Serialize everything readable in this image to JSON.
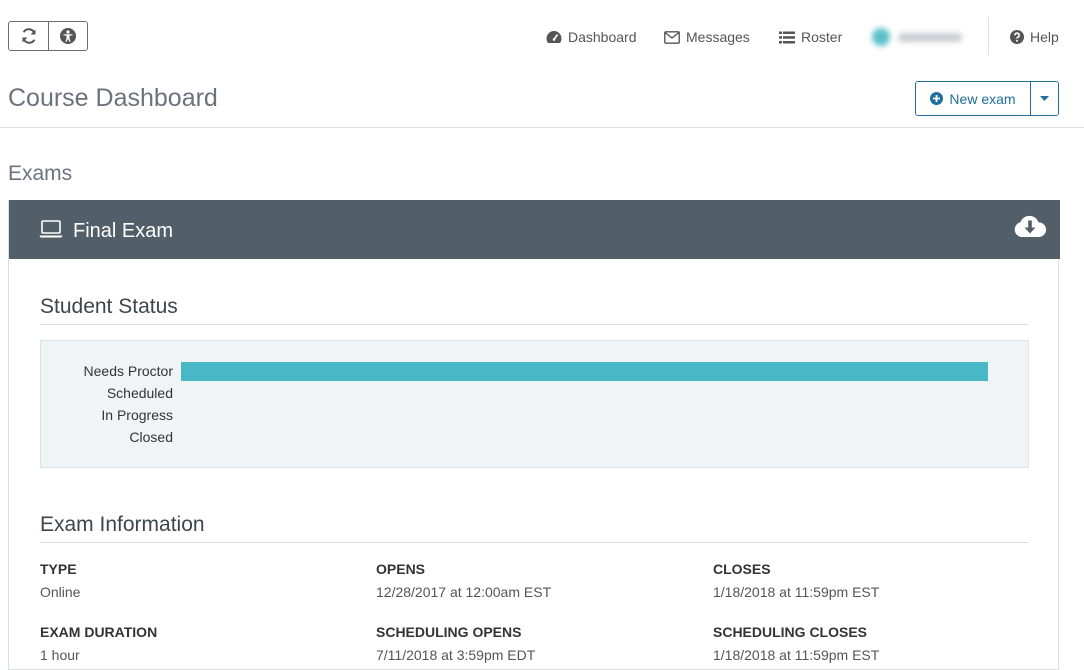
{
  "toolbar": {
    "refresh_icon": "refresh-icon",
    "accessibility_icon": "accessibility-icon"
  },
  "nav": {
    "dashboard": "Dashboard",
    "messages": "Messages",
    "roster": "Roster",
    "help": "Help"
  },
  "header": {
    "title": "Course Dashboard",
    "new_exam_label": "New exam"
  },
  "exams": {
    "section_label": "Exams",
    "exam": {
      "title": "Final Exam",
      "student_status_heading": "Student Status",
      "status_rows": [
        {
          "label": "Needs Proctor",
          "fraction": 1.0
        },
        {
          "label": "Scheduled",
          "fraction": 0
        },
        {
          "label": "In Progress",
          "fraction": 0
        },
        {
          "label": "Closed",
          "fraction": 0
        }
      ],
      "exam_info_heading": "Exam Information",
      "info": [
        {
          "key": "TYPE",
          "value": "Online"
        },
        {
          "key": "OPENS",
          "value": "12/28/2017 at 12:00am EST"
        },
        {
          "key": "CLOSES",
          "value": "1/18/2018 at 11:59pm EST"
        },
        {
          "key": "EXAM DURATION",
          "value": "1 hour"
        },
        {
          "key": "SCHEDULING OPENS",
          "value": "7/11/2018 at 3:59pm EDT"
        },
        {
          "key": "SCHEDULING CLOSES",
          "value": "1/18/2018 at 11:59pm EST"
        }
      ]
    }
  },
  "colors": {
    "panel_header": "#535f68",
    "status_bar": "#48b8c6",
    "primary": "#1f6e9e"
  }
}
